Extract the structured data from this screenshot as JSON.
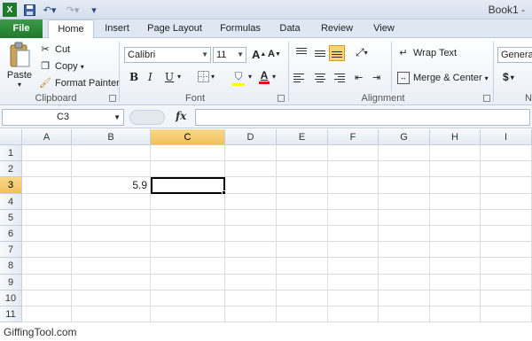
{
  "titlebar": {
    "app_title": "Book1 -",
    "quick_access": [
      "excel-logo-icon",
      "save-icon",
      "undo-icon",
      "redo-icon",
      "customize-icon"
    ]
  },
  "tabs": [
    "File",
    "Home",
    "Insert",
    "Page Layout",
    "Formulas",
    "Data",
    "Review",
    "View"
  ],
  "ribbon": {
    "clipboard": {
      "paste": "Paste",
      "cut": "Cut",
      "copy": "Copy",
      "format_painter": "Format Painter",
      "label": "Clipboard"
    },
    "font": {
      "name": "Calibri",
      "size": "11",
      "bold": "B",
      "italic": "I",
      "underline": "U",
      "font_color": "A",
      "label": "Font"
    },
    "alignment": {
      "wrap_text": "Wrap Text",
      "merge_center": "Merge & Center",
      "label": "Alignment"
    },
    "number": {
      "format": "General",
      "currency": "$",
      "label": "N"
    }
  },
  "formula_bar": {
    "name_box": "C3",
    "fx": "fx",
    "value": ""
  },
  "sheet": {
    "columns": [
      "A",
      "B",
      "C",
      "D",
      "E",
      "F",
      "G",
      "H",
      "I"
    ],
    "rows": [
      "1",
      "2",
      "3",
      "4",
      "5",
      "6",
      "7",
      "8",
      "9",
      "10",
      "11"
    ],
    "selected_column": "C",
    "selected_row": "3",
    "cells": {
      "B3": "5.9"
    }
  },
  "watermark": "GiffingTool.com",
  "colors": {
    "file_tab": "#1f7a2d",
    "selection_header": "#f1c05a",
    "highlight_button": "#f7d56a"
  }
}
